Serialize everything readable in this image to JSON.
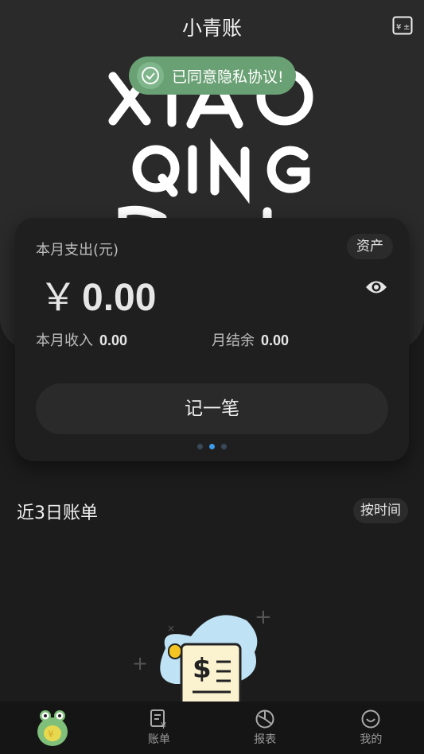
{
  "app": {
    "title": "小青账"
  },
  "toast": {
    "text": "已同意隐私协议!"
  },
  "summary": {
    "expense_label": "本月支出(元)",
    "currency": "￥",
    "expense_amount": "0.00",
    "asset_label": "资产",
    "income_label": "本月收入",
    "income_value": "0.00",
    "balance_label": "月结余",
    "balance_value": "0.00",
    "record_label": "记一笔"
  },
  "recent": {
    "title": "近3日账单",
    "sort_label": "按时间"
  },
  "tabs": [
    {
      "label": "账单",
      "icon": "bill-icon"
    },
    {
      "label": "报表",
      "icon": "pie-chart-icon"
    },
    {
      "label": "我的",
      "icon": "smile-icon"
    }
  ],
  "logo": {
    "line1": "XIAO",
    "line2": "QING"
  },
  "colors": {
    "accent": "#3d9ae8",
    "toast": "#6aa174",
    "background": "#1c1c1c"
  }
}
